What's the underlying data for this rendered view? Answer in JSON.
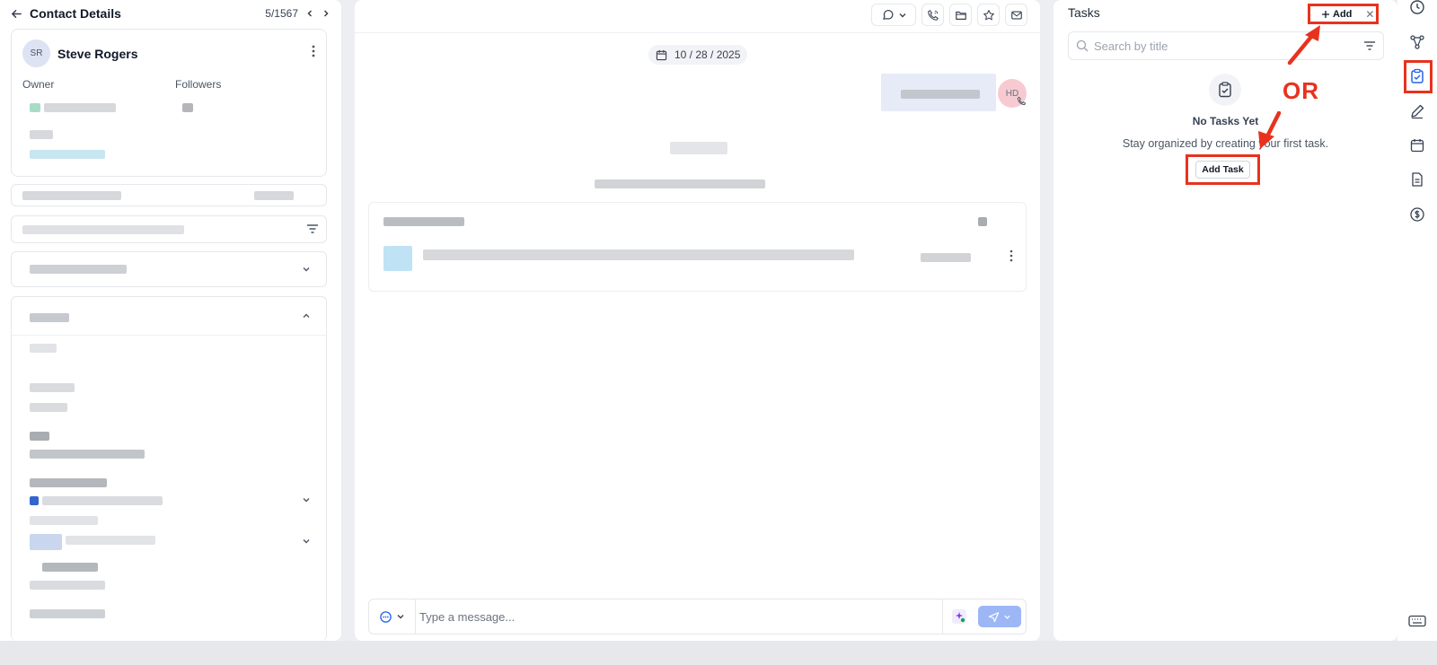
{
  "left_panel": {
    "title": "Contact Details",
    "pager": "5/1567",
    "contact": {
      "initials": "SR",
      "name": "Steve Rogers",
      "owner_label": "Owner",
      "followers_label": "Followers"
    }
  },
  "conversation": {
    "date": "10 / 28 / 2025",
    "agent_avatar": "HD",
    "composer": {
      "placeholder": "Type a message..."
    }
  },
  "tasks": {
    "title": "Tasks",
    "add_label": "Add",
    "close_label": "✕",
    "search_placeholder": "Search by title",
    "empty_title": "No Tasks Yet",
    "empty_subtitle": "Stay organized by creating your first task.",
    "add_task_label": "Add Task"
  },
  "annotation": {
    "or_label": "OR",
    "highlight_color": "#e8321e"
  },
  "right_rail": {
    "icons": [
      "clock-icon",
      "workflow-icon",
      "tasks-icon",
      "notes-icon",
      "calendar-icon",
      "document-icon",
      "dollar-icon",
      "keyboard-icon"
    ]
  }
}
